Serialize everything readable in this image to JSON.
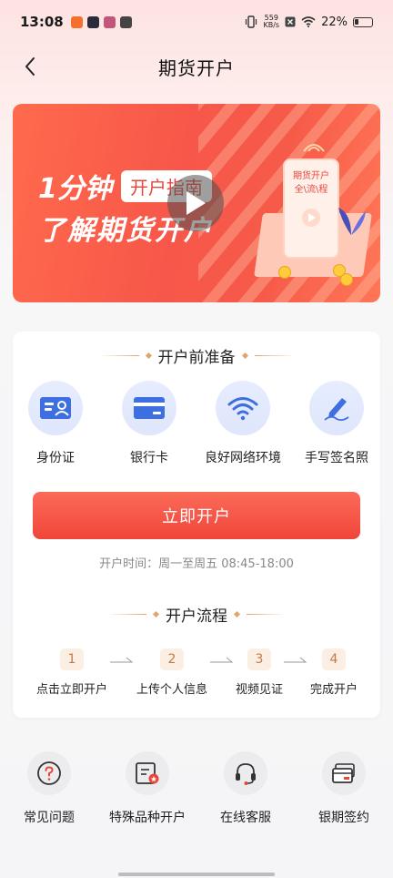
{
  "status_bar": {
    "time": "13:08",
    "net_speed_value": "559",
    "net_speed_unit": "KB/s",
    "battery": "22%"
  },
  "header": {
    "title": "期货开户"
  },
  "banner": {
    "line1_prefix": "1分钟",
    "guide_tag": "开户指南",
    "line2": "了解期货开户",
    "phone_text_1": "期货开户",
    "phone_text_2": "全\\流\\程"
  },
  "preparation": {
    "title": "开户前准备",
    "items": [
      {
        "label": "身份证",
        "icon": "id-card-icon"
      },
      {
        "label": "银行卡",
        "icon": "bank-card-icon"
      },
      {
        "label": "良好网络环境",
        "icon": "wifi-icon"
      },
      {
        "label": "手写签名照",
        "icon": "signature-pen-icon"
      }
    ]
  },
  "open_account": {
    "button_label": "立即开户",
    "hours": "开户时间：周一至周五 08:45-18:00"
  },
  "process": {
    "title": "开户流程",
    "steps": [
      {
        "num": "1",
        "label": "点击立即开户"
      },
      {
        "num": "2",
        "label": "上传个人信息"
      },
      {
        "num": "3",
        "label": "视频见证"
      },
      {
        "num": "4",
        "label": "完成开户"
      }
    ]
  },
  "services": [
    {
      "label": "常见问题",
      "icon": "question-icon"
    },
    {
      "label": "特殊品种开户",
      "icon": "special-product-icon"
    },
    {
      "label": "在线客服",
      "icon": "headset-icon"
    },
    {
      "label": "银期签约",
      "icon": "bank-futures-sign-icon"
    }
  ],
  "colors": {
    "primary": "#f1453a",
    "accent_gold": "#e2a46a",
    "icon_blue": "#3d6fe0"
  }
}
